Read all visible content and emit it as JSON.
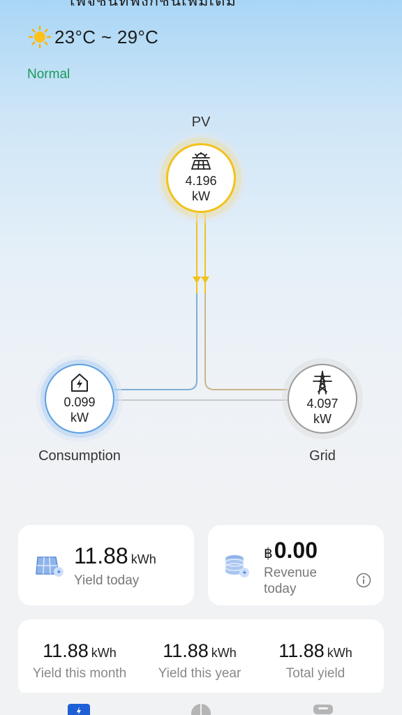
{
  "header": {
    "top_clipped_text": "เพจชันทีฟังก์ชันเพิ่มเติม",
    "weather_temp": "23°C ~ 29°C",
    "status": "Normal"
  },
  "flow": {
    "pv": {
      "label": "PV",
      "value": "4.196",
      "unit": "kW"
    },
    "consumption": {
      "label": "Consumption",
      "value": "0.099",
      "unit": "kW"
    },
    "grid": {
      "label": "Grid",
      "value": "4.097",
      "unit": "kW"
    }
  },
  "cards": {
    "yield_today": {
      "value": "11.88",
      "unit": "kWh",
      "label": "Yield today"
    },
    "revenue_today": {
      "currency": "฿",
      "value": "0.00",
      "label_line1": "Revenue",
      "label_line2": "today"
    }
  },
  "totals": [
    {
      "value": "11.88",
      "unit": "kWh",
      "label": "Yield this month"
    },
    {
      "value": "11.88",
      "unit": "kWh",
      "label": "Yield this year"
    },
    {
      "value": "11.88",
      "unit": "kWh",
      "label": "Total yield"
    }
  ],
  "colors": {
    "pv_accent": "#f2c21b",
    "consumption_accent": "#5b9fe0",
    "grid_accent": "#9a9a9a",
    "status_green": "#1a9a5a",
    "nav_active": "#1f5fd6"
  },
  "icons": {
    "weather": "sun-icon",
    "pv": "solar-panel-icon",
    "consumption": "house-lightning-icon",
    "grid": "power-tower-icon",
    "yield": "solar-module-icon",
    "revenue": "coin-stack-icon",
    "info": "info-icon"
  }
}
